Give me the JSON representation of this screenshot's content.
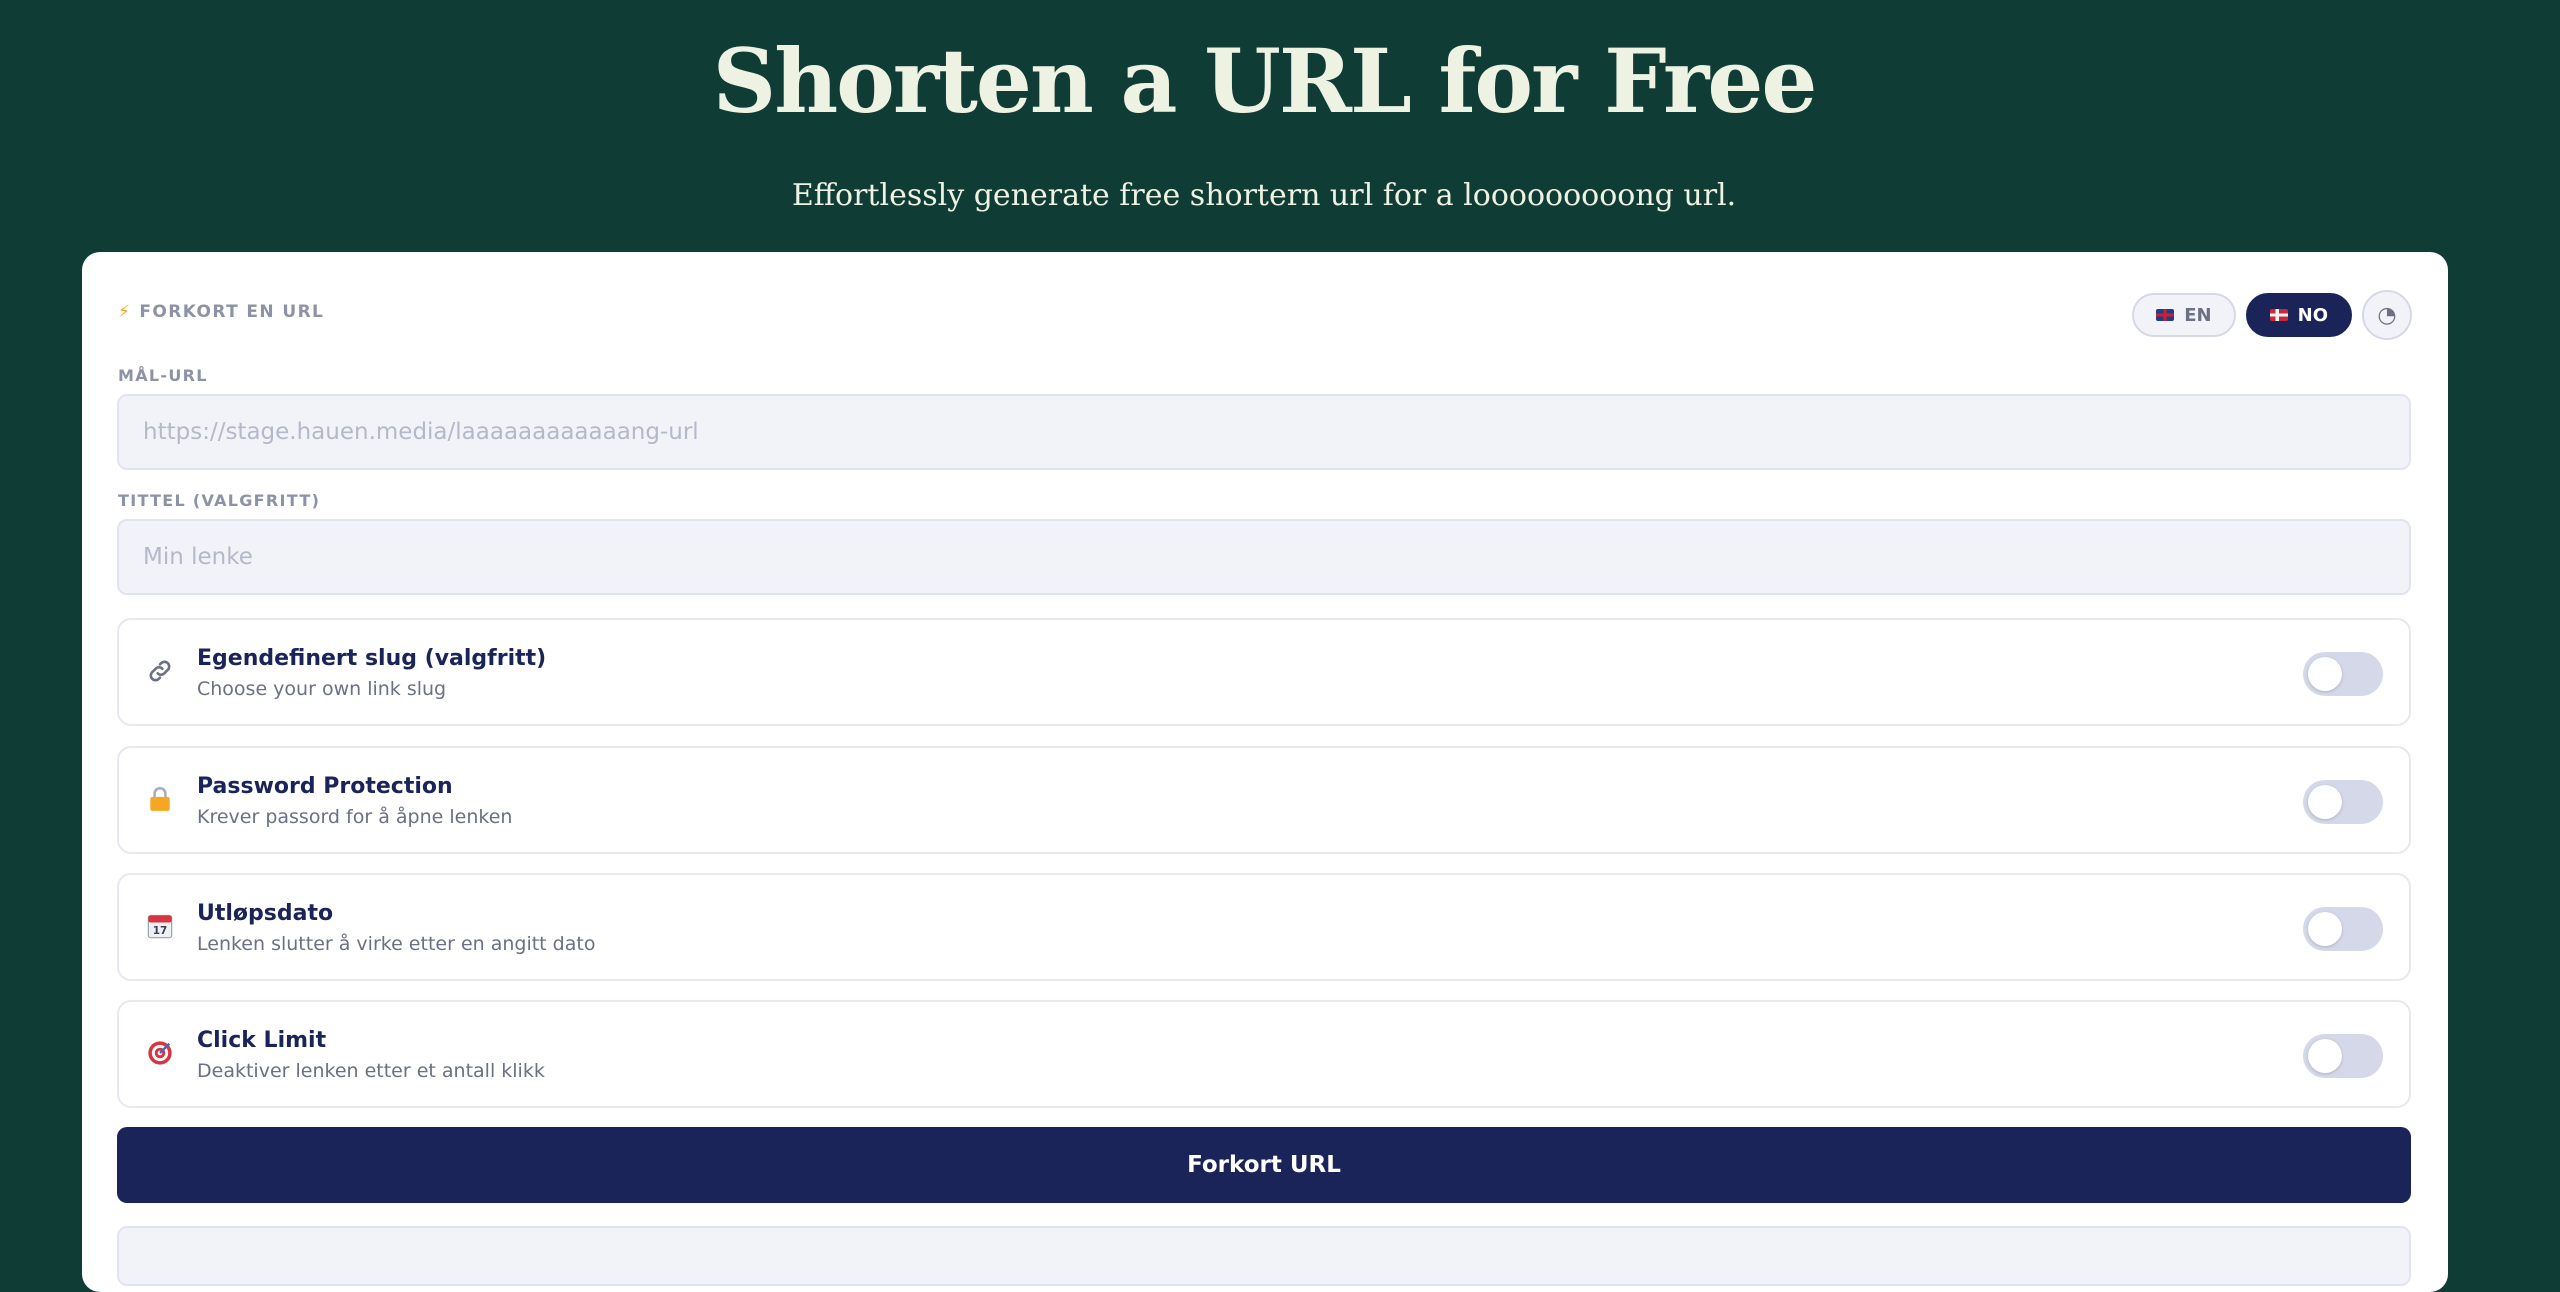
{
  "hero": {
    "title": "Shorten a URL for Free",
    "subtitle": "Effortlessly generate free shortern url for a looooooooong url."
  },
  "form": {
    "header_label": "FORKORT EN URL",
    "header_icon": "lightning-bolt-icon",
    "languages": [
      {
        "code": "EN",
        "flag": "gb-flag-icon",
        "active": false
      },
      {
        "code": "NO",
        "flag": "no-flag-icon",
        "active": true
      }
    ],
    "theme_icon": "◔",
    "target_url": {
      "label": "MÅL-URL",
      "placeholder": "https://stage.hauen.media/laaaaaaaaaaaang-url",
      "value": ""
    },
    "title_field": {
      "label": "TITTEL (VALGFRITT)",
      "placeholder": "Min lenke",
      "value": ""
    },
    "options": [
      {
        "icon": "link-icon",
        "title": "Egendefinert slug (valgfritt)",
        "desc": "Choose your own link slug",
        "enabled": false
      },
      {
        "icon": "lock-icon",
        "title": "Password Protection",
        "desc": "Krever passord for å åpne lenken",
        "enabled": false
      },
      {
        "icon": "calendar-icon",
        "title": "Utløpsdato",
        "desc": "Lenken slutter å virke etter en angitt dato",
        "enabled": false
      },
      {
        "icon": "target-icon",
        "title": "Click Limit",
        "desc": "Deaktiver lenken etter et antall klikk",
        "enabled": false
      }
    ],
    "submit_label": "Forkort URL"
  },
  "colors": {
    "background": "#0f3d36",
    "hero_text": "#eef2e2",
    "primary": "#1b2459",
    "accent": "#f5a623"
  }
}
